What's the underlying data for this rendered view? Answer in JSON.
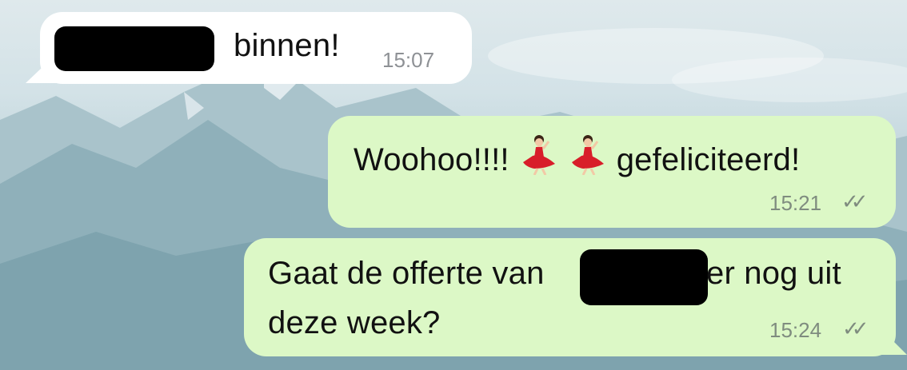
{
  "chat": {
    "messages": [
      {
        "direction": "incoming",
        "text_visible": "binnen!",
        "time": "15:07",
        "redacted": true
      },
      {
        "direction": "outgoing",
        "text_before": "Woohoo!!!!",
        "emoji": [
          "dancer-emoji",
          "dancer-emoji"
        ],
        "text_after": "gefeliciteerd!",
        "time": "15:21",
        "status": "✓✓"
      },
      {
        "direction": "outgoing",
        "line1_before": "Gaat de offerte van",
        "line1_after": "er nog uit",
        "line2": "deze week?",
        "time": "15:24",
        "status": "✓✓",
        "redacted": true
      }
    ]
  },
  "colors": {
    "incoming_bubble": "#ffffff",
    "outgoing_bubble": "#dcf8c6",
    "timestamp": "#7f8c7f"
  }
}
